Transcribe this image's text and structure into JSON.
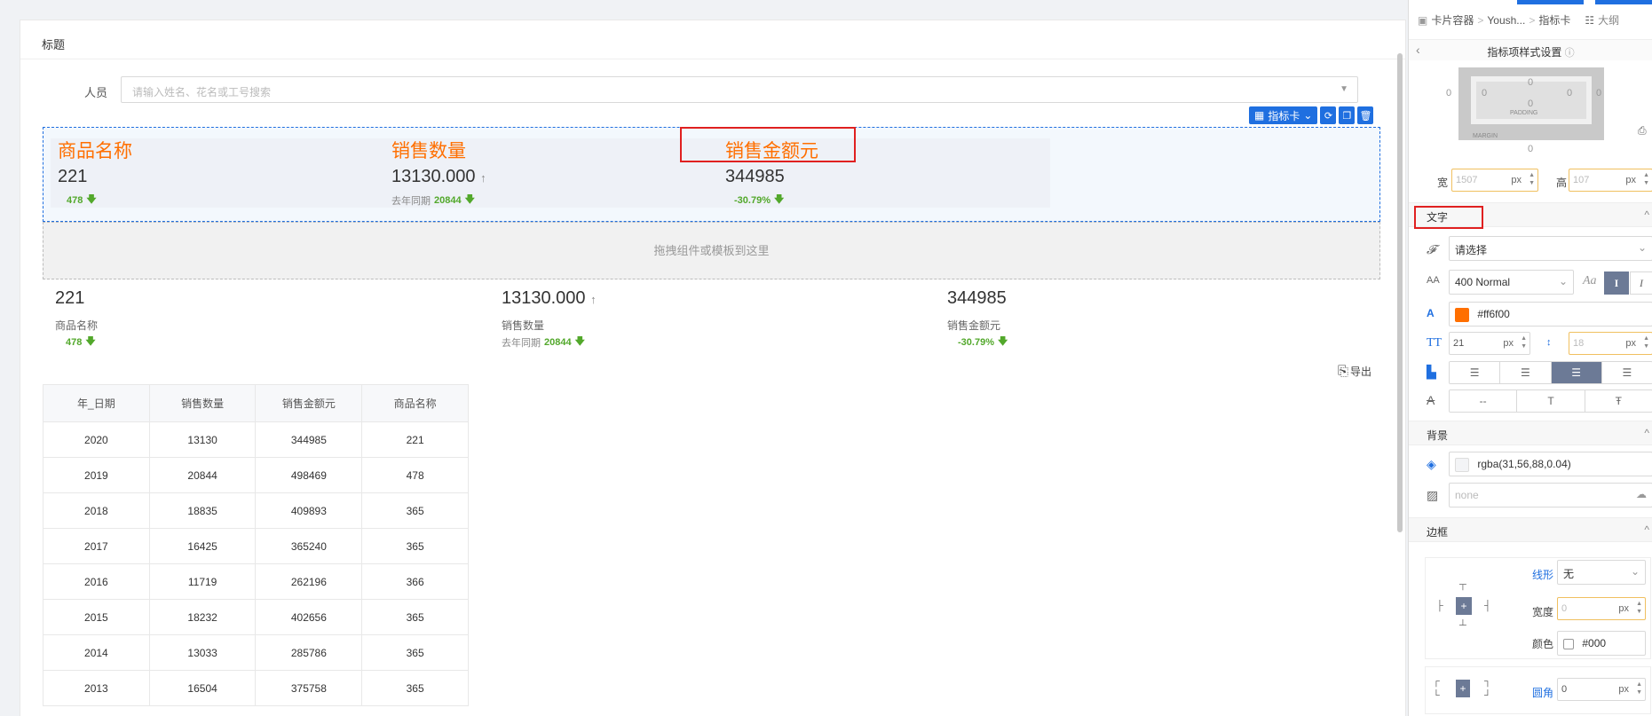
{
  "panel": {
    "title": "标题"
  },
  "filter": {
    "label": "人员",
    "placeholder": "请输入姓名、花名或工号搜索"
  },
  "toolbar": {
    "label": "指标卡"
  },
  "card": {
    "kpis": [
      {
        "name": "商品名称",
        "value": "221",
        "sub_label": "",
        "sub_value": "478"
      },
      {
        "name": "销售数量",
        "value": "13130.000",
        "sub_label": "去年同期",
        "sub_value": "20844"
      },
      {
        "name": "销售金额元",
        "value": "344985",
        "sub_label": "",
        "sub_value": "-30.79%"
      }
    ]
  },
  "drop_zone": {
    "text": "拖拽组件或模板到这里"
  },
  "kpis2": [
    {
      "value": "221",
      "name": "商品名称",
      "sub_label": "",
      "sub_value": "478"
    },
    {
      "value": "13130.000",
      "name": "销售数量",
      "sub_label": "去年同期",
      "sub_value": "20844"
    },
    {
      "value": "344985",
      "name": "销售金额元",
      "sub_label": "",
      "sub_value": "-30.79%"
    }
  ],
  "export_label": "导出",
  "table": {
    "headers": [
      "年_日期",
      "销售数量",
      "销售金额元",
      "商品名称"
    ],
    "rows": [
      [
        "2020",
        "13130",
        "344985",
        "221"
      ],
      [
        "2019",
        "20844",
        "498469",
        "478"
      ],
      [
        "2018",
        "18835",
        "409893",
        "365"
      ],
      [
        "2017",
        "16425",
        "365240",
        "365"
      ],
      [
        "2016",
        "11719",
        "262196",
        "366"
      ],
      [
        "2015",
        "18232",
        "402656",
        "365"
      ],
      [
        "2014",
        "13033",
        "285786",
        "365"
      ],
      [
        "2013",
        "16504",
        "375758",
        "365"
      ]
    ]
  },
  "rp": {
    "crumbs": [
      "卡片容器",
      "Yoush...",
      "指标卡",
      "大纲"
    ],
    "header": "指标项样式设置",
    "box_model": {
      "padding_label": "PADDING",
      "margin_label": "MARGIN",
      "zero": "0"
    },
    "width_label": "宽",
    "width_value": "1507",
    "height_label": "高",
    "height_value": "107",
    "unit": "px",
    "text_section": "文字",
    "font_select": "请选择",
    "font_weight": "400 Normal",
    "font_color": "#ff6f00",
    "font_size": "21",
    "line_height": "18",
    "decoration": [
      "--",
      "T",
      "Ŧ"
    ],
    "bg_section": "背景",
    "bg_color": "rgba(31,56,88,0.04)",
    "bg_image": "none",
    "border_section": "边框",
    "line_style_label": "线形",
    "line_style_value": "无",
    "border_width_label": "宽度",
    "border_width_value": "0",
    "border_color_label": "颜色",
    "border_color_value": "#000",
    "radius_label": "圆角",
    "radius_value": "0"
  },
  "colors": {
    "accent": "#1f6fe0",
    "kpi_name": "#ff6f00",
    "trend": "#52a82b",
    "highlight": "#e02020"
  }
}
